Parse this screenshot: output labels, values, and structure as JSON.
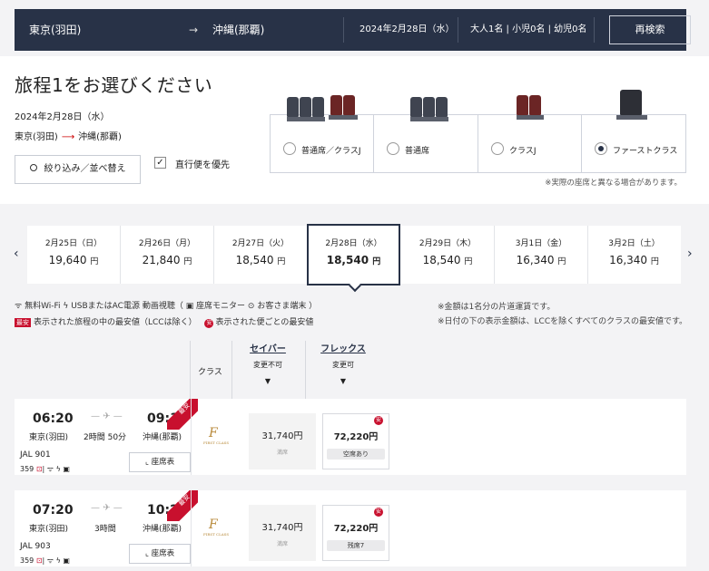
{
  "search": {
    "origin": "東京(羽田)",
    "arrow": "→",
    "destination": "沖縄(那覇)",
    "date": "2024年2月28日（水）",
    "passengers": "大人1名 | 小児0名 | 幼児0名",
    "research_label": "再検索"
  },
  "header": {
    "title": "旅程1をお選びください",
    "date": "2024年2月28日（水）",
    "origin": "東京(羽田)",
    "destination": "沖縄(那覇)"
  },
  "filter": {
    "button_label": "絞り込み／並べ替え",
    "direct_label": "直行便を優先",
    "direct_checked": true
  },
  "cabins": [
    {
      "label": "普通席／クラスJ",
      "selected": false
    },
    {
      "label": "普通席",
      "selected": false
    },
    {
      "label": "クラスJ",
      "selected": false
    },
    {
      "label": "ファーストクラス",
      "selected": true
    }
  ],
  "seat_note": "※実際の座席と異なる場合があります。",
  "dates": [
    {
      "date": "2月25日（日）",
      "price": "19,640",
      "yen": "円"
    },
    {
      "date": "2月26日（月）",
      "price": "21,840",
      "yen": "円"
    },
    {
      "date": "2月27日（火）",
      "price": "18,540",
      "yen": "円"
    },
    {
      "date": "2月28日（水）",
      "price": "18,540",
      "yen": "円",
      "selected": true
    },
    {
      "date": "2月29日（木）",
      "price": "18,540",
      "yen": "円"
    },
    {
      "date": "3月1日（金）",
      "price": "16,340",
      "yen": "円"
    },
    {
      "date": "3月2日（土）",
      "price": "16,340",
      "yen": "円"
    }
  ],
  "legend": {
    "line1": "ᯤ 無料Wi-Fi ϟ USBまたはAC電源 動画視聴（ ▣ 座席モニター ⊙ お客さま端末 ）",
    "cheapest_badge": "最安",
    "cheapest_text": "表示された旅程の中の最安値（LCCは除く）",
    "an_badge": "安",
    "an_text": "表示された便ごとの最安値",
    "note1": "※金額は1名分の片道運賃です。",
    "note2": "※日付の下の表示金額は、LCCを除くすべてのクラスの最安値です。"
  },
  "fare_header": {
    "class_label": "クラス",
    "saver": {
      "name": "セイバー",
      "sub": "変更不可",
      "tri": "▼"
    },
    "flex": {
      "name": "フレックス",
      "sub": "変更可",
      "tri": "▼"
    }
  },
  "flights": [
    {
      "dep_time": "06:20",
      "dep_airport": "東京(羽田)",
      "duration": "2時間 50分",
      "arr_time": "09:10",
      "arr_airport": "沖縄(那覇)",
      "flight_no": "JAL 901",
      "equipment": "359",
      "seat_map_label": "座席表",
      "badge": "最安",
      "class_logo": "F",
      "class_logo_sub": "FIRST CLASS",
      "saver_price": "31,740円",
      "saver_status": "満席",
      "flex_price": "72,220円",
      "flex_status": "空席あり",
      "flex_badge": "安"
    },
    {
      "dep_time": "07:20",
      "dep_airport": "東京(羽田)",
      "duration": "3時間",
      "arr_time": "10:20",
      "arr_airport": "沖縄(那覇)",
      "flight_no": "JAL 903",
      "equipment": "359",
      "seat_map_label": "座席表",
      "badge": "最安",
      "class_logo": "F",
      "class_logo_sub": "FIRST CLASS",
      "saver_price": "31,740円",
      "saver_status": "満席",
      "flex_price": "72,220円",
      "flex_status": "残席7",
      "flex_badge": "安"
    }
  ]
}
